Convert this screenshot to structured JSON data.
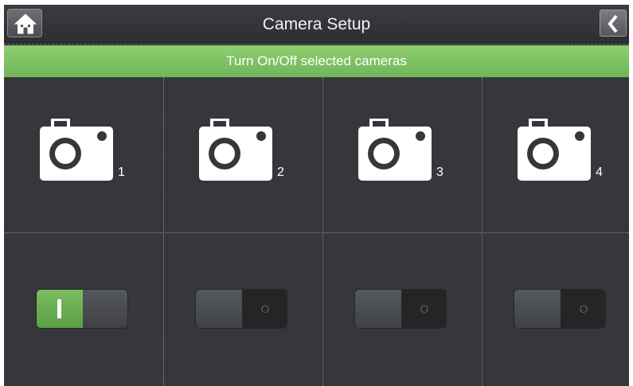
{
  "header": {
    "title": "Camera Setup"
  },
  "banner": {
    "text": "Turn On/Off selected cameras"
  },
  "cameras": [
    {
      "number": "1",
      "enabled": true
    },
    {
      "number": "2",
      "enabled": false,
      "off_symbol": "O"
    },
    {
      "number": "3",
      "enabled": false,
      "off_symbol": "O"
    },
    {
      "number": "4",
      "enabled": false,
      "off_symbol": "O"
    }
  ],
  "icons": {
    "home": "home-icon",
    "back": "chevron-left-icon",
    "camera": "camera-icon"
  },
  "colors": {
    "accent_green": "#7cbd5f",
    "background": "#35373a"
  }
}
